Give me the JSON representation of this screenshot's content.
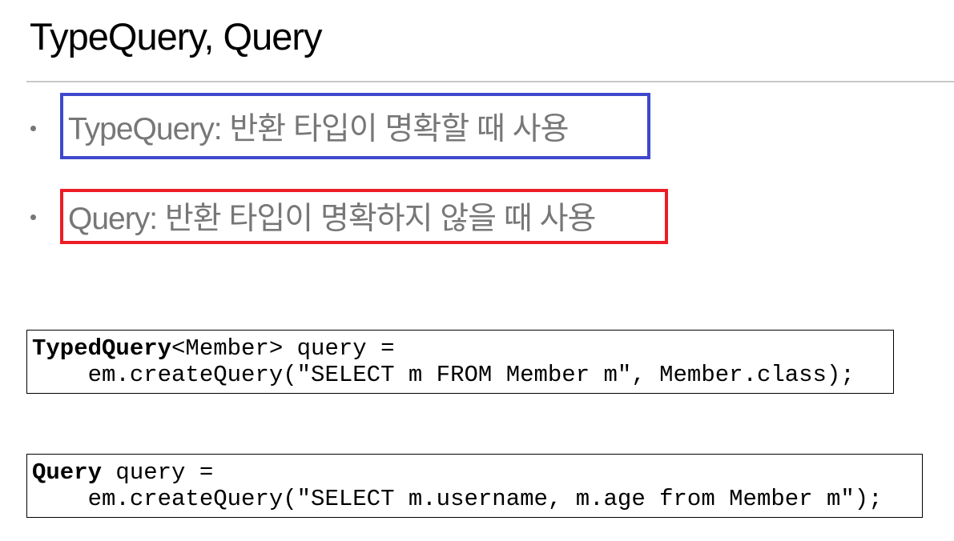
{
  "title": "TypeQuery, Query",
  "bullets": [
    {
      "text": "TypeQuery: 반환 타입이 명확할 때 사용",
      "highlight_color": "#3f48cc"
    },
    {
      "text": "Query: 반환 타입이 명확하지 않을 때 사용",
      "highlight_color": "#ed1c24"
    }
  ],
  "code_blocks": [
    {
      "keyword": "TypedQuery",
      "line1_rest": "<Member> query =",
      "line2": "    em.createQuery(\"SELECT m FROM Member m\", Member.class);"
    },
    {
      "keyword": "Query",
      "line1_rest": " query =",
      "line2": "    em.createQuery(\"SELECT m.username, m.age from Member m\");"
    }
  ]
}
